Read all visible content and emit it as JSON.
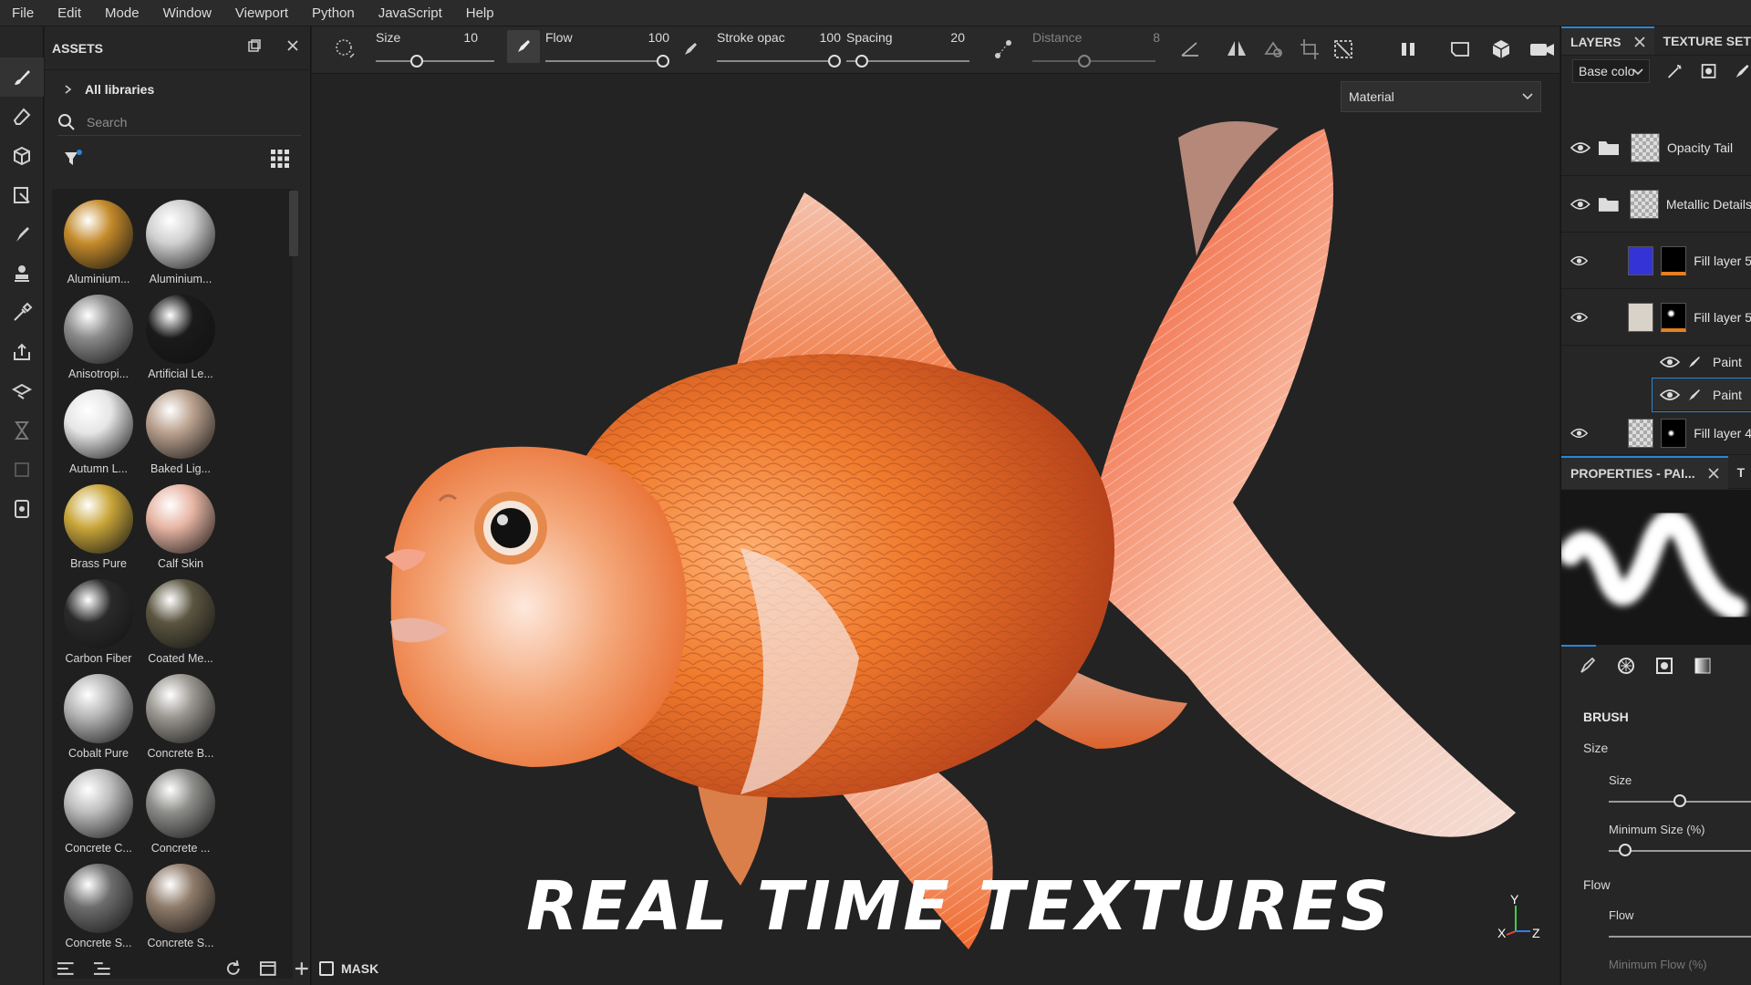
{
  "menu": [
    "File",
    "Edit",
    "Mode",
    "Window",
    "Viewport",
    "Python",
    "JavaScript",
    "Help"
  ],
  "assets": {
    "title": "ASSETS",
    "library": "All libraries",
    "search_placeholder": "Search",
    "items": [
      {
        "label": "Aluminium...",
        "color": "#c48a2a"
      },
      {
        "label": "Aluminium...",
        "color": "#cfcfcf"
      },
      {
        "label": "Anisotropi...",
        "color": "#8a8a8a"
      },
      {
        "label": "Artificial Le...",
        "color": "#1a1a1a"
      },
      {
        "label": "Autumn L...",
        "color": "#e6e6e6"
      },
      {
        "label": "Baked Lig...",
        "color": "#b9a08d"
      },
      {
        "label": "Brass Pure",
        "color": "#c9a63a"
      },
      {
        "label": "Calf Skin",
        "color": "#e7b5a3"
      },
      {
        "label": "Carbon Fiber",
        "color": "#2a2a2a"
      },
      {
        "label": "Coated Me...",
        "color": "#5b5540"
      },
      {
        "label": "Cobalt Pure",
        "color": "#b4b4b4"
      },
      {
        "label": "Concrete B...",
        "color": "#9a9690"
      },
      {
        "label": "Concrete C...",
        "color": "#bdbdbd"
      },
      {
        "label": "Concrete ...",
        "color": "#8d8d8a"
      },
      {
        "label": "Concrete S...",
        "color": "#6d6d6d"
      },
      {
        "label": "Concrete S...",
        "color": "#8f7b6a"
      }
    ]
  },
  "toolbar": {
    "size_label": "Size",
    "size_value": "10",
    "flow_label": "Flow",
    "flow_value": "100",
    "stroke_label": "Stroke opac",
    "stroke_value": "100",
    "spacing_label": "Spacing",
    "spacing_value": "20",
    "distance_label": "Distance",
    "distance_value": "8"
  },
  "viewport": {
    "material_select": "Material",
    "overlay_title": "REAL TIME TEXTURES",
    "mask_label": "MASK",
    "axis_y": "Y",
    "axis_x": "X",
    "axis_z": "Z"
  },
  "layers": {
    "tab_label": "LAYERS",
    "tab2_label": "TEXTURE SET",
    "channel": "Base colo",
    "items": [
      {
        "name": "Opacity Tail"
      },
      {
        "name": "Metallic Details"
      },
      {
        "name": "Fill layer 5"
      },
      {
        "name": "Fill layer 5"
      },
      {
        "name": "Paint"
      },
      {
        "name": "Paint"
      },
      {
        "name": "Fill layer 4"
      }
    ]
  },
  "properties": {
    "tab_label": "PROPERTIES - PAI...",
    "tab2_label": "T",
    "section": "BRUSH",
    "size_group": "Size",
    "size_label": "Size",
    "min_size_label": "Minimum Size (%)",
    "flow_group": "Flow",
    "flow_label": "Flow",
    "min_flow_label": "Minimum Flow (%)"
  },
  "colors": {
    "accent": "#2a85d6",
    "layer_marker": "#e67e22",
    "fill_blue": "#3434d6"
  }
}
